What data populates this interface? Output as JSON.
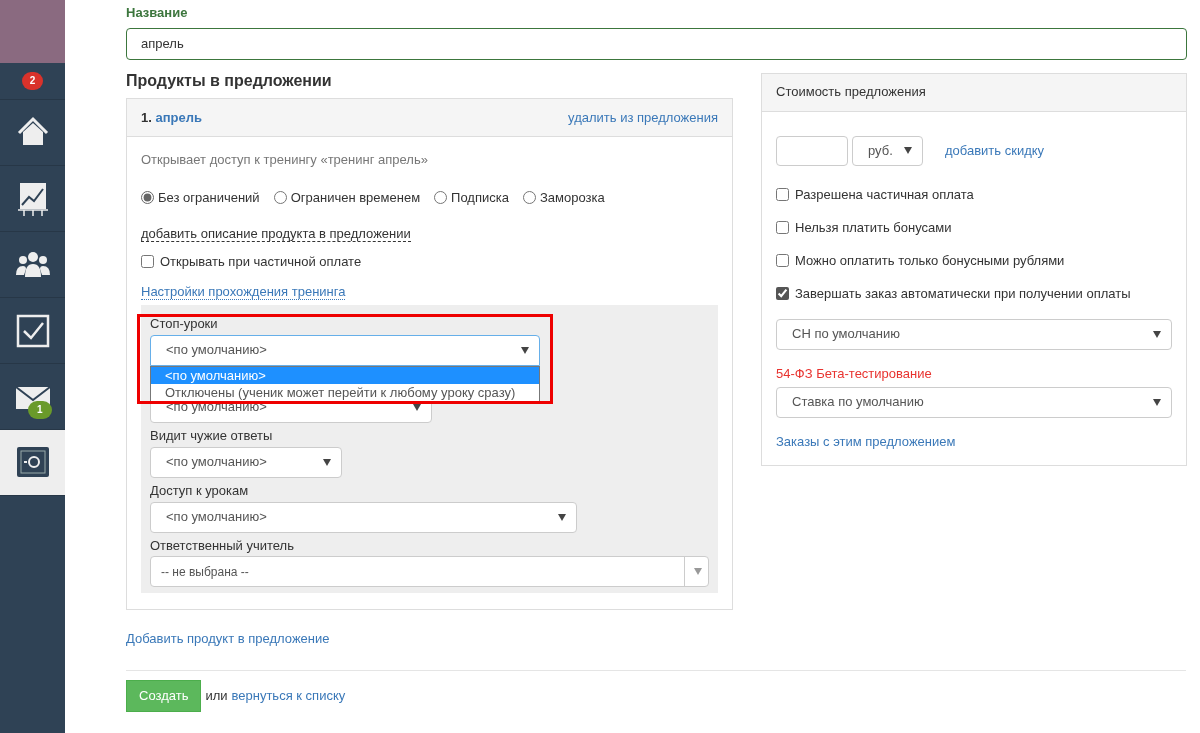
{
  "sidebar": {
    "notification_badge": "2",
    "items": [
      {
        "kind": "home",
        "selected": false
      },
      {
        "kind": "chart",
        "selected": false
      },
      {
        "kind": "people",
        "selected": false
      },
      {
        "kind": "tasks",
        "selected": false
      },
      {
        "kind": "mail",
        "badge": "1",
        "selected": false
      },
      {
        "kind": "safe",
        "selected": true
      }
    ]
  },
  "name_field": {
    "label": "Название",
    "value": "апрель"
  },
  "products_heading": "Продукты в предложении",
  "product": {
    "number": "1.",
    "title": "апрель",
    "remove_link": "удалить из предложения",
    "access_text": "Открывает доступ к тренингу «тренинг апрель»",
    "access_options": [
      {
        "label": "Без ограничений",
        "selected": true
      },
      {
        "label": "Ограничен временем",
        "selected": false
      },
      {
        "label": "Подписка",
        "selected": false
      },
      {
        "label": "Заморозка",
        "selected": false
      }
    ],
    "description_link": "добавить описание продукта в предложении",
    "partial_open": {
      "label": "Открывать при частичной оплате",
      "checked": false
    },
    "settings_link": "Настройки прохождения тренинга",
    "settings": [
      {
        "label": "Стоп-уроки",
        "value": "<по умолчанию>",
        "expanded": true,
        "highlighted": true,
        "options": [
          {
            "label": "<по умолчанию>",
            "selected": true
          },
          {
            "label": "Отключены (ученик может перейти к любому уроку сразу)",
            "selected": false
          }
        ]
      },
      {
        "value": "<по умолчанию>",
        "expanded": false
      },
      {
        "label": "Видит чужие ответы",
        "value": "<по умолчанию>",
        "expanded": false
      },
      {
        "label": "Доступ к урокам",
        "value": "<по умолчанию>",
        "expanded": false
      },
      {
        "label": "Ответственный учитель",
        "value": "-- не выбрана --",
        "kind": "combo",
        "expanded": false
      }
    ]
  },
  "add_product_link": "Добавить продукт в предложение",
  "footer": {
    "create_button": "Создать",
    "or_text": "или",
    "back_link": "вернуться к списку"
  },
  "price_panel": {
    "title": "Стоимость предложения",
    "currency": "руб.",
    "discount_link": "добавить скидку",
    "options": [
      {
        "label": "Разрешена частичная оплата",
        "checked": false
      },
      {
        "label": "Нельзя платить бонусами",
        "checked": false
      },
      {
        "label": "Можно оплатить только бонусными рублями",
        "checked": false
      },
      {
        "label": "Завершать заказ автоматически при получении оплаты",
        "checked": true
      }
    ],
    "tax_system": "СН по умолчанию",
    "fz_label": "54-ФЗ Бета-тестирование",
    "vat": "Ставка по умолчанию",
    "orders_link": "Заказы с этим предложением"
  }
}
